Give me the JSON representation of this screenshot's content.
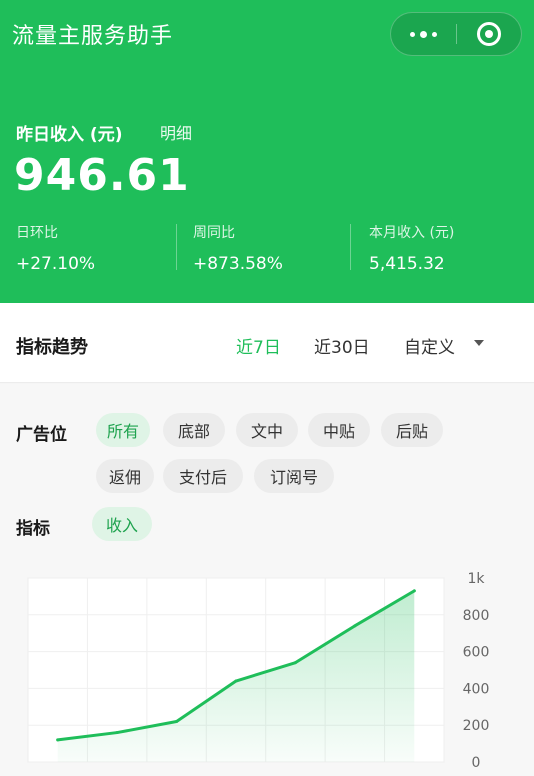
{
  "app": {
    "title": "流量主服务助手"
  },
  "header": {
    "income_label": "昨日收入 (元)",
    "detail_link": "明细",
    "income_value": "946.61",
    "stats": [
      {
        "label": "日环比",
        "value": "+27.10%"
      },
      {
        "label": "周同比",
        "value": "+873.58%"
      },
      {
        "label": "本月收入 (元)",
        "value": "5,415.32"
      }
    ]
  },
  "trend": {
    "title": "指标趋势",
    "ranges": [
      "近7日",
      "近30日",
      "自定义"
    ],
    "active_range": "近7日"
  },
  "filters": {
    "ad_position_label": "广告位",
    "ad_positions": [
      "所有",
      "底部",
      "文中",
      "中贴",
      "后贴",
      "返佣",
      "支付后",
      "订阅号"
    ],
    "active_ad_position": "所有",
    "metric_label": "指标",
    "metrics": [
      "收入"
    ],
    "active_metric": "收入"
  },
  "colors": {
    "brand": "#1fbe5a",
    "chip_active_bg": "#dff4e6",
    "chip_bg": "#ececec"
  },
  "icons": {
    "more": "more-dots-icon",
    "close": "capsule-close-icon",
    "dropdown": "dropdown-caret-icon"
  },
  "chart_data": {
    "type": "area",
    "series": [
      {
        "values": [
          120,
          160,
          220,
          440,
          540,
          740,
          930
        ]
      }
    ],
    "y_ticks": [
      "0",
      "200",
      "400",
      "600",
      "800",
      "1k"
    ],
    "ylim": [
      0,
      1000
    ],
    "grid": true,
    "color": "#1fbe5a"
  }
}
